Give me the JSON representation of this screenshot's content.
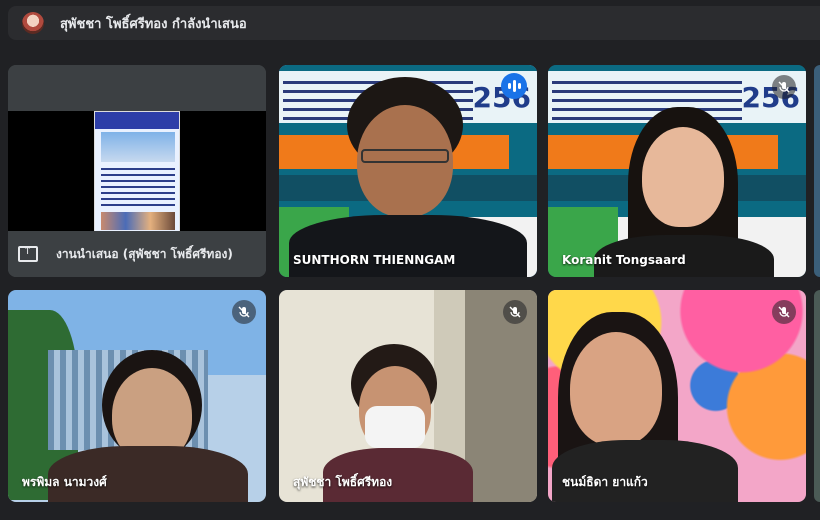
{
  "header": {
    "presenter_status": "สุพัชชา โพธิ์ศรีทอง กำลังนำเสนอ"
  },
  "tiles": [
    {
      "name": "งานนำเสนอ (สุพัชชา โพธิ์ศรีทอง)",
      "type": "presentation",
      "icon": "present-screen-icon"
    },
    {
      "name": "SUNTHORN THIENNGAM",
      "status": "speaking",
      "highlighted": true,
      "icon": "speaking-indicator-icon"
    },
    {
      "name": "Koranit Tongsaard",
      "status": "muted",
      "icon": "mic-off-icon"
    },
    {
      "name": "พรพิมล นามวงศ์",
      "status": "muted",
      "icon": "mic-off-icon"
    },
    {
      "name": "สุพัชชา โพธิ์ศรีทอง",
      "status": "muted",
      "icon": "mic-off-icon"
    },
    {
      "name": "ชนม์ธิดา ยาแก้ว",
      "status": "muted",
      "icon": "mic-off-icon"
    }
  ],
  "slide": {
    "year": "256"
  },
  "colors": {
    "background": "#202124",
    "active_outline": "#8ab4f8",
    "speaking": "#1a73e8"
  }
}
